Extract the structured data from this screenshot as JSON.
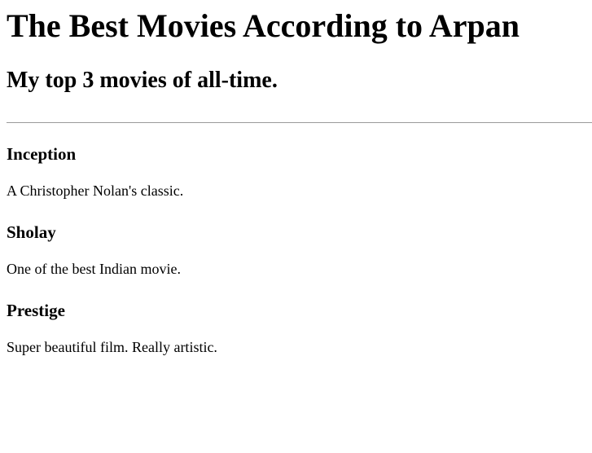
{
  "page": {
    "title": "The Best Movies According to Arpan",
    "subtitle": "My top 3 movies of all-time."
  },
  "movies": [
    {
      "name": "Inception",
      "description": "A Christopher Nolan's classic."
    },
    {
      "name": "Sholay",
      "description": "One of the best Indian movie."
    },
    {
      "name": "Prestige",
      "description": "Super beautiful film. Really artistic."
    }
  ]
}
